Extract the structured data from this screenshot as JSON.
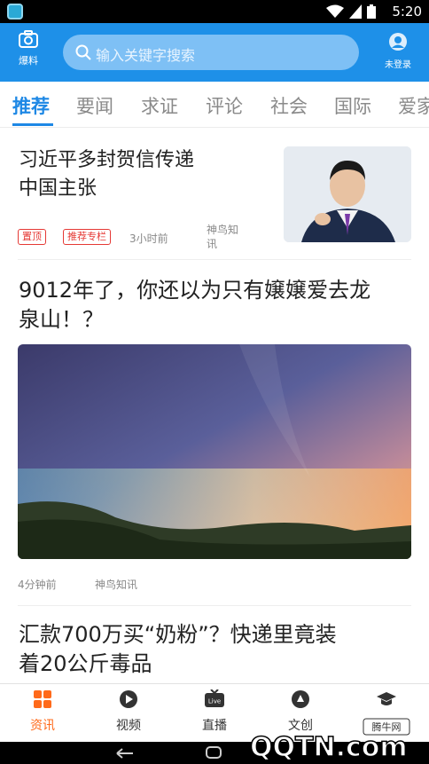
{
  "status_bar": {
    "time": "5:20"
  },
  "header": {
    "left_button_label": "爆料",
    "search_placeholder": "输入关键字搜索",
    "right_button_label": "未登录",
    "accent": "#1e90e8"
  },
  "tabs": [
    {
      "label": "推荐",
      "active": true
    },
    {
      "label": "要闻"
    },
    {
      "label": "求证"
    },
    {
      "label": "评论"
    },
    {
      "label": "社会"
    },
    {
      "label": "国际"
    },
    {
      "label": "爱家"
    }
  ],
  "feed": {
    "items": [
      {
        "title_line1": "习近平多封贺信传递",
        "title_line2": "中国主张",
        "badges": [
          "置顶",
          "推荐专栏"
        ],
        "time": "3小时前",
        "source_line1": "神鸟知",
        "source_line2": "讯"
      },
      {
        "title_line1": "9012年了，你还以为只有嬢嬢爱去龙",
        "title_line2": "泉山！？",
        "time": "4分钟前",
        "source": "神鸟知讯"
      },
      {
        "title_line1": "汇款700万买“奶粉”？快递里竟装",
        "title_line2": "着20公斤毒品"
      }
    ]
  },
  "bottom_nav": [
    {
      "label": "资讯",
      "icon": "grid-icon",
      "active": true
    },
    {
      "label": "视频",
      "icon": "play-icon"
    },
    {
      "label": "直播",
      "icon": "live-tv-icon",
      "badge": "Live"
    },
    {
      "label": "文创",
      "icon": "creative-icon"
    },
    {
      "label": "教育",
      "icon": "graduation-cap-icon"
    }
  ],
  "watermark": {
    "text": "QQTN.com",
    "tag": "腾牛网"
  },
  "colors": {
    "active_tab": "#1e88e5",
    "bottom_active": "#ff6a1a",
    "badge_red": "#e53935"
  }
}
